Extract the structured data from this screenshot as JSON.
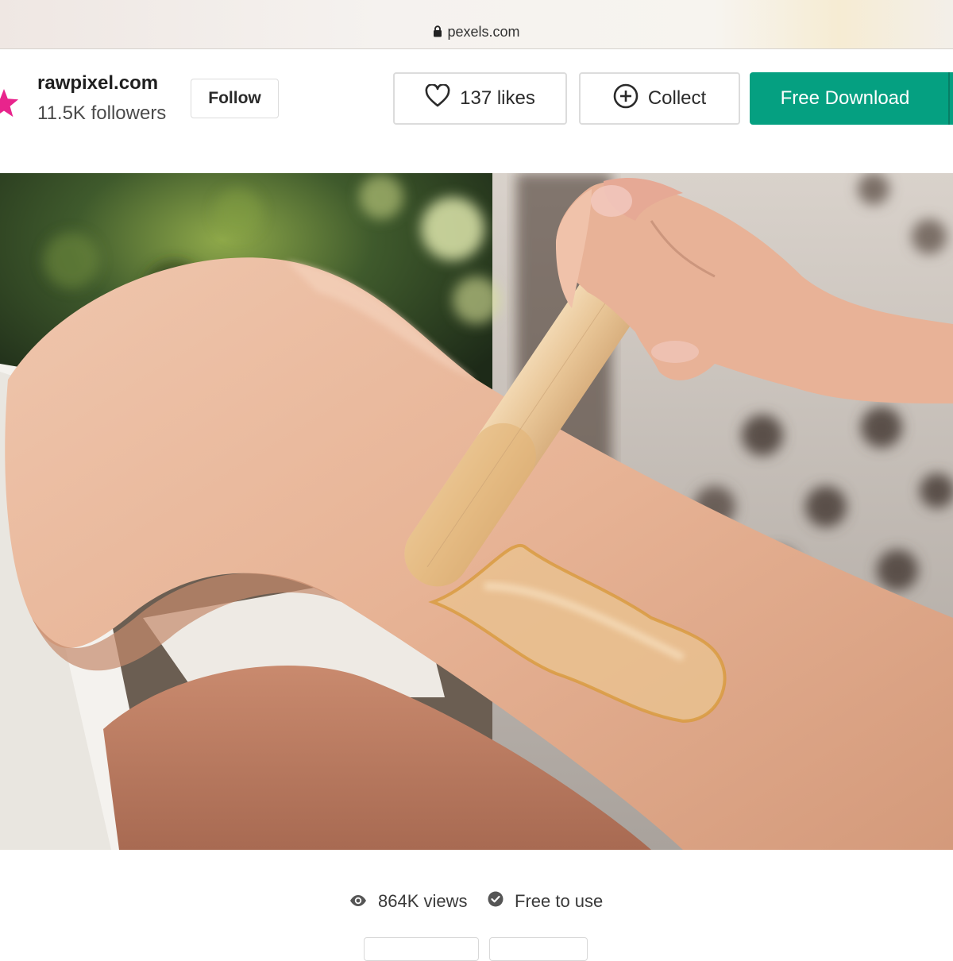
{
  "browser": {
    "url": "pexels.com",
    "icons": {
      "lock": "lock-icon"
    }
  },
  "author": {
    "name": "rawpixel.com",
    "followers": "11.5K followers",
    "avatar_icon": "star-icon",
    "avatar_color": "#e8248c"
  },
  "actions": {
    "follow_label": "Follow",
    "likes_label": "137 likes",
    "collect_label": "Collect",
    "download_label": "Free Download",
    "icons": {
      "like": "heart-icon",
      "collect": "plus-circle-icon"
    },
    "download_color": "#05a081"
  },
  "photo": {
    "subject": "photo"
  },
  "stats": {
    "views_label": "864K views",
    "license_label": "Free to use",
    "icons": {
      "views": "eye-icon",
      "license": "check-circle-icon"
    }
  }
}
